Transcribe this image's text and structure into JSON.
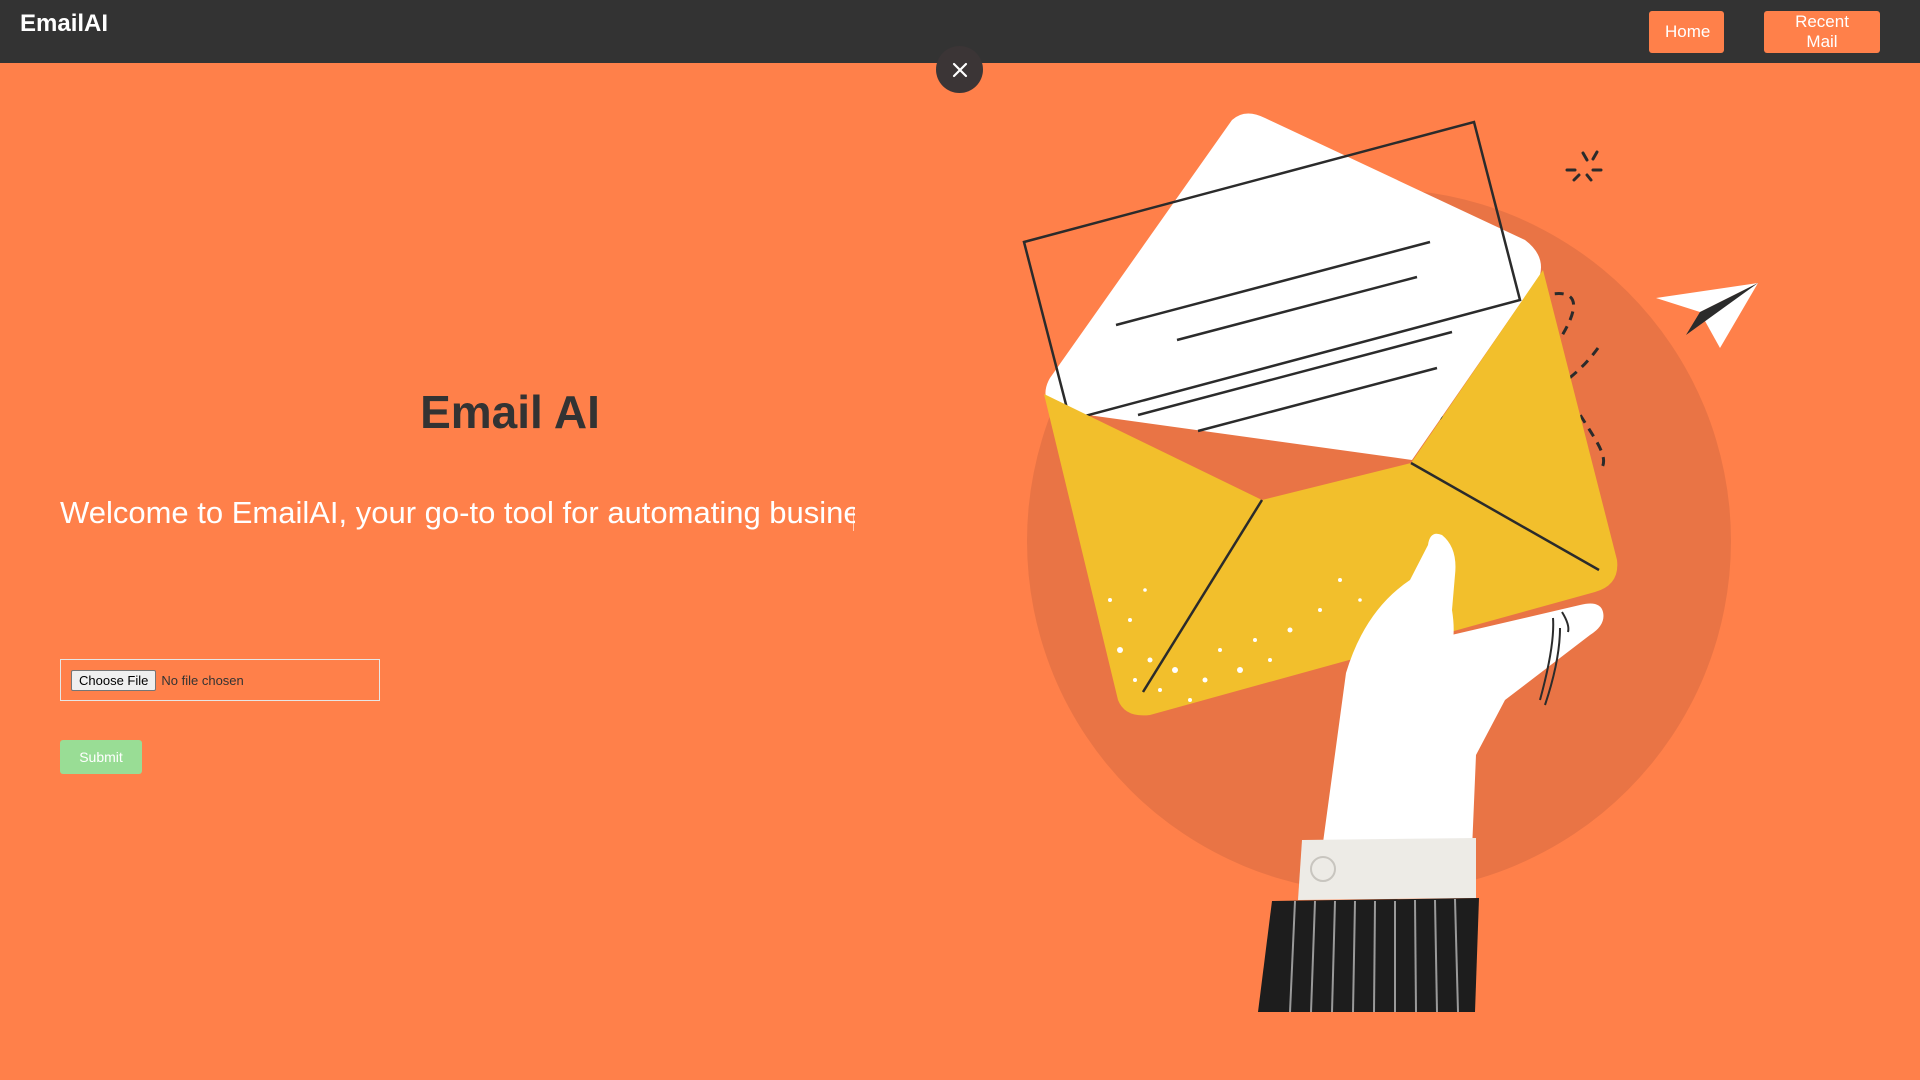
{
  "header": {
    "brand": "EmailAI",
    "nav": {
      "home_label": "Home",
      "recent_mail_label": "Recent Mail"
    }
  },
  "overlay": {
    "close_icon": "close-icon"
  },
  "main": {
    "title": "Email AI",
    "welcome_text": "Welcome to EmailAI, your go-to tool for automating busines",
    "file_input": {
      "button_label": "Choose File",
      "status": "No file chosen"
    },
    "submit_label": "Submit"
  },
  "illustration": {
    "icon": "hand-holding-envelope-illustration"
  },
  "colors": {
    "background": "#FF804A",
    "header": "#333333",
    "title": "#333333",
    "submit": "#99DD95",
    "envelope": "#F2BF2C",
    "circle": "#E97445"
  }
}
